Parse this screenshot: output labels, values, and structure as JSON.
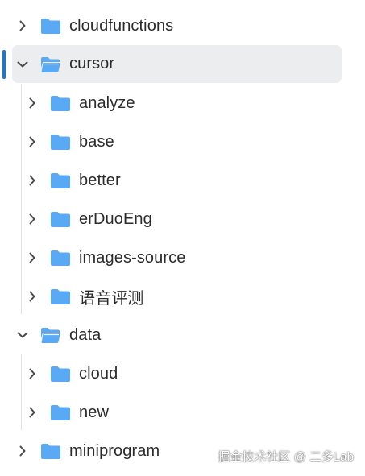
{
  "tree": {
    "items": [
      {
        "label": "cloudfunctions",
        "expanded": false,
        "depth": 0,
        "selected": false
      },
      {
        "label": "cursor",
        "expanded": true,
        "depth": 0,
        "selected": true
      },
      {
        "label": "analyze",
        "expanded": false,
        "depth": 1,
        "selected": false
      },
      {
        "label": "base",
        "expanded": false,
        "depth": 1,
        "selected": false
      },
      {
        "label": "better",
        "expanded": false,
        "depth": 1,
        "selected": false
      },
      {
        "label": "erDuoEng",
        "expanded": false,
        "depth": 1,
        "selected": false
      },
      {
        "label": "images-source",
        "expanded": false,
        "depth": 1,
        "selected": false
      },
      {
        "label": "语音评测",
        "expanded": false,
        "depth": 1,
        "selected": false
      },
      {
        "label": "data",
        "expanded": true,
        "depth": 0,
        "selected": false
      },
      {
        "label": "cloud",
        "expanded": false,
        "depth": 1,
        "selected": false
      },
      {
        "label": "new",
        "expanded": false,
        "depth": 1,
        "selected": false
      },
      {
        "label": "miniprogram",
        "expanded": false,
        "depth": 0,
        "selected": false
      }
    ]
  },
  "watermark": {
    "text": "掘金技术社区 @ 二多Lab"
  },
  "colors": {
    "folder": "#5aa9f4",
    "folder_open": "#5aa9f4",
    "selected_bg": "#ecedee",
    "accent": "#1a73e8",
    "text": "#2b2b2b",
    "chevron": "#4a4a4a"
  },
  "icons": {
    "collapsed": "chevron-right-icon",
    "expanded": "chevron-down-icon",
    "folder": "folder-icon",
    "folder_open": "folder-open-icon"
  }
}
